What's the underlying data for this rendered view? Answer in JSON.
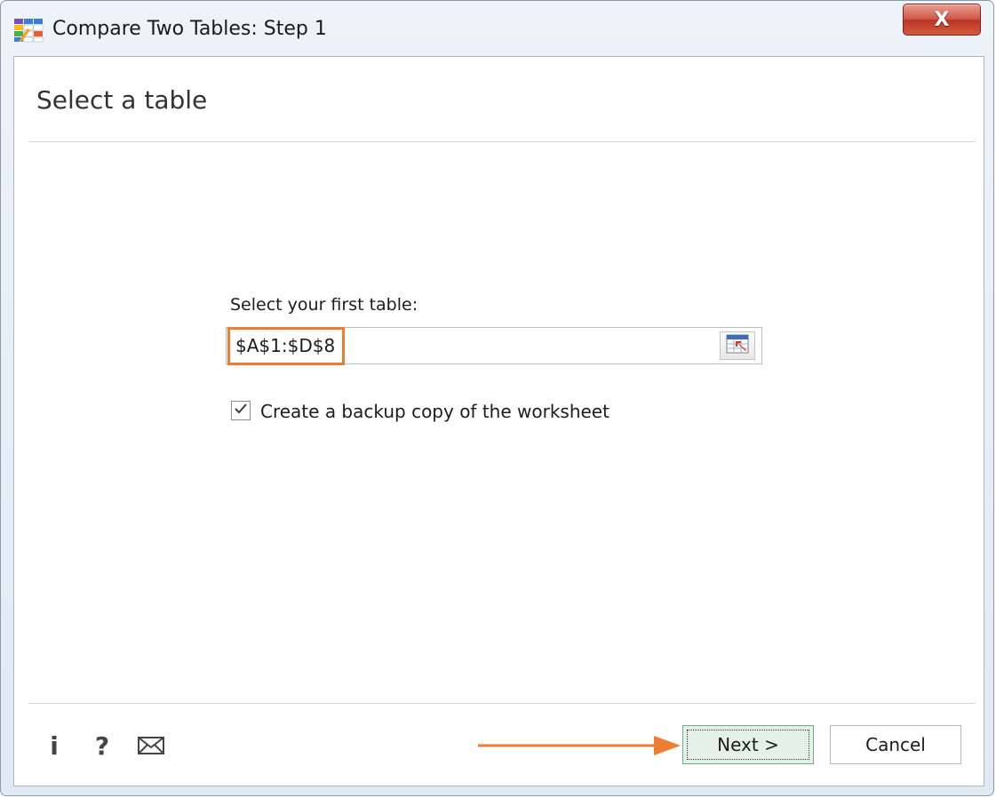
{
  "window": {
    "title": "Compare Two Tables: Step 1",
    "close_glyph": "X"
  },
  "page": {
    "heading": "Select a table"
  },
  "form": {
    "range_label": "Select your first table:",
    "range_value": "$A$1:$D$8",
    "backup_checked": true,
    "backup_label": "Create a backup copy of the worksheet"
  },
  "footer": {
    "info_glyph": "i",
    "help_glyph": "?",
    "next_label": "Next >",
    "cancel_label": "Cancel"
  },
  "icons": {
    "app": "compare-tables-icon",
    "range_picker": "range-select-icon",
    "mail": "mail-icon",
    "arrow": "arrow-right-icon"
  },
  "colors": {
    "highlight": "#ed7d31",
    "close_button": "#c73a2b",
    "next_button_bg": "#e5f1e8"
  }
}
